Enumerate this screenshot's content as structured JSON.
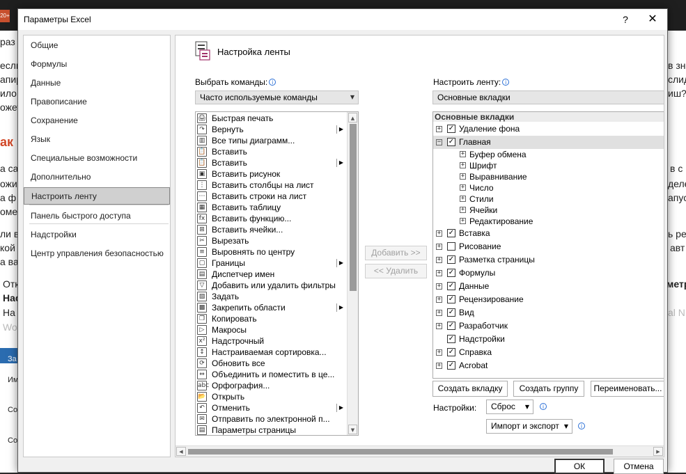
{
  "background": {
    "left_fragments": [
      {
        "text": "раз",
        "style": ""
      },
      {
        "text": "если",
        "style": ""
      },
      {
        "text": "апир",
        "style": ""
      },
      {
        "text": "ило",
        "style": ""
      },
      {
        "text": "ожет",
        "style": ""
      },
      {
        "text": "ак",
        "style": "orange"
      },
      {
        "text": "а са",
        "style": ""
      },
      {
        "text": "ожим",
        "style": ""
      },
      {
        "text": "а ф",
        "style": ""
      },
      {
        "text": "омен",
        "style": ""
      },
      {
        "text": "ли в",
        "style": ""
      },
      {
        "text": "кой",
        "style": ""
      },
      {
        "text": "а ва",
        "style": ""
      },
      {
        "text": "Отк",
        "style": ""
      },
      {
        "text": "Нас",
        "style": "bold"
      },
      {
        "text": "На",
        "style": ""
      },
      {
        "text": "Wo",
        "style": "gray"
      }
    ],
    "right_fragments": [
      {
        "text": "в зн",
        "style": ""
      },
      {
        "text": "слид",
        "style": ""
      },
      {
        "text": "иш?",
        "style": ""
      },
      {
        "text": "в с",
        "style": ""
      },
      {
        "text": "деле",
        "style": ""
      },
      {
        "text": "апус",
        "style": ""
      },
      {
        "text": "ь ре",
        "style": ""
      },
      {
        "text": "авт",
        "style": ""
      },
      {
        "text": "метр",
        "style": "bold"
      },
      {
        "text": "al N",
        "style": "gray"
      }
    ],
    "strip_labels": [
      "За",
      "Им",
      "Со",
      "Со"
    ]
  },
  "dialog": {
    "title": "Параметры Excel",
    "help_glyph": "?",
    "close_glyph": "✕"
  },
  "nav": {
    "items": [
      {
        "label": "Общие",
        "selected": false
      },
      {
        "label": "Формулы",
        "selected": false
      },
      {
        "label": "Данные",
        "selected": false
      },
      {
        "label": "Правописание",
        "selected": false
      },
      {
        "label": "Сохранение",
        "selected": false
      },
      {
        "label": "Язык",
        "selected": false
      },
      {
        "label": "Специальные возможности",
        "selected": false
      },
      {
        "label": "Дополнительно",
        "selected": false
      },
      {
        "label": "Настроить ленту",
        "selected": true
      },
      {
        "label": "Панель быстрого доступа",
        "selected": false
      },
      {
        "label": "Надстройки",
        "selected": false
      },
      {
        "label": "Центр управления безопасностью",
        "selected": false
      }
    ]
  },
  "ribbon": {
    "header_title": "Настройка ленты",
    "choose_commands_label": "Выбрать команды:",
    "choose_commands_value": "Часто используемые команды",
    "customize_ribbon_label": "Настроить ленту:",
    "customize_ribbon_value": "Основные вкладки",
    "add_button": "Добавить >>",
    "remove_button": "<< Удалить",
    "commands": [
      {
        "label": "Быстрая печать",
        "icon": "🖨",
        "submenu": false
      },
      {
        "label": "Вернуть",
        "icon": "↷",
        "submenu": true
      },
      {
        "label": "Все типы диаграмм...",
        "icon": "▥",
        "submenu": false
      },
      {
        "label": "Вставить",
        "icon": "📋",
        "submenu": false
      },
      {
        "label": "Вставить",
        "icon": "📋",
        "submenu": true
      },
      {
        "label": "Вставить рисунок",
        "icon": "▣",
        "submenu": false
      },
      {
        "label": "Вставить столбцы на лист",
        "icon": "⋮",
        "submenu": false
      },
      {
        "label": "Вставить строки на лист",
        "icon": "⋯",
        "submenu": false
      },
      {
        "label": "Вставить таблицу",
        "icon": "▦",
        "submenu": false
      },
      {
        "label": "Вставить функцию...",
        "icon": "fx",
        "submenu": false
      },
      {
        "label": "Вставить ячейки...",
        "icon": "⊞",
        "submenu": false
      },
      {
        "label": "Вырезать",
        "icon": "✂",
        "submenu": false
      },
      {
        "label": "Выровнять по центру",
        "icon": "≡",
        "submenu": false
      },
      {
        "label": "Границы",
        "icon": "▢",
        "submenu": true
      },
      {
        "label": "Диспетчер имен",
        "icon": "▤",
        "submenu": false
      },
      {
        "label": "Добавить или удалить фильтры",
        "icon": "▽",
        "submenu": false
      },
      {
        "label": "Задать",
        "icon": "▧",
        "submenu": false
      },
      {
        "label": "Закрепить области",
        "icon": "▩",
        "submenu": true
      },
      {
        "label": "Копировать",
        "icon": "❐",
        "submenu": false
      },
      {
        "label": "Макросы",
        "icon": "▷",
        "submenu": false
      },
      {
        "label": "Надстрочный",
        "icon": "x²",
        "submenu": false
      },
      {
        "label": "Настраиваемая сортировка...",
        "icon": "↕",
        "submenu": false
      },
      {
        "label": "Обновить все",
        "icon": "⟳",
        "submenu": false
      },
      {
        "label": "Объединить и поместить в це...",
        "icon": "⇔",
        "submenu": false
      },
      {
        "label": "Орфография...",
        "icon": "abc",
        "submenu": false
      },
      {
        "label": "Открыть",
        "icon": "📂",
        "submenu": false
      },
      {
        "label": "Отменить",
        "icon": "↶",
        "submenu": true
      },
      {
        "label": "Отправить по электронной п...",
        "icon": "✉",
        "submenu": false
      },
      {
        "label": "Параметры страницы",
        "icon": "▤",
        "submenu": false
      }
    ],
    "tree_header": "Основные вкладки",
    "tree": [
      {
        "label": "Удаление фона",
        "level": 0,
        "expander": "+",
        "checkbox": true,
        "checked": true,
        "selected": false
      },
      {
        "label": "Главная",
        "level": 0,
        "expander": "−",
        "checkbox": true,
        "checked": true,
        "selected": true
      },
      {
        "label": "Буфер обмена",
        "level": 1,
        "expander": "+",
        "checkbox": false,
        "checked": false,
        "selected": false
      },
      {
        "label": "Шрифт",
        "level": 1,
        "expander": "+",
        "checkbox": false,
        "checked": false,
        "selected": false
      },
      {
        "label": "Выравнивание",
        "level": 1,
        "expander": "+",
        "checkbox": false,
        "checked": false,
        "selected": false
      },
      {
        "label": "Число",
        "level": 1,
        "expander": "+",
        "checkbox": false,
        "checked": false,
        "selected": false
      },
      {
        "label": "Стили",
        "level": 1,
        "expander": "+",
        "checkbox": false,
        "checked": false,
        "selected": false
      },
      {
        "label": "Ячейки",
        "level": 1,
        "expander": "+",
        "checkbox": false,
        "checked": false,
        "selected": false
      },
      {
        "label": "Редактирование",
        "level": 1,
        "expander": "+",
        "checkbox": false,
        "checked": false,
        "selected": false
      },
      {
        "label": "Вставка",
        "level": 0,
        "expander": "+",
        "checkbox": true,
        "checked": true,
        "selected": false
      },
      {
        "label": "Рисование",
        "level": 0,
        "expander": "+",
        "checkbox": true,
        "checked": false,
        "selected": false
      },
      {
        "label": "Разметка страницы",
        "level": 0,
        "expander": "+",
        "checkbox": true,
        "checked": true,
        "selected": false
      },
      {
        "label": "Формулы",
        "level": 0,
        "expander": "+",
        "checkbox": true,
        "checked": true,
        "selected": false
      },
      {
        "label": "Данные",
        "level": 0,
        "expander": "+",
        "checkbox": true,
        "checked": true,
        "selected": false
      },
      {
        "label": "Рецензирование",
        "level": 0,
        "expander": "+",
        "checkbox": true,
        "checked": true,
        "selected": false
      },
      {
        "label": "Вид",
        "level": 0,
        "expander": "+",
        "checkbox": true,
        "checked": true,
        "selected": false
      },
      {
        "label": "Разработчик",
        "level": 0,
        "expander": "+",
        "checkbox": true,
        "checked": true,
        "selected": false
      },
      {
        "label": "Надстройки",
        "level": 0,
        "expander": "",
        "checkbox": true,
        "checked": true,
        "selected": false
      },
      {
        "label": "Справка",
        "level": 0,
        "expander": "+",
        "checkbox": true,
        "checked": true,
        "selected": false
      },
      {
        "label": "Acrobat",
        "level": 0,
        "expander": "+",
        "checkbox": true,
        "checked": true,
        "selected": false
      }
    ],
    "new_tab_button": "Создать вкладку",
    "new_group_button": "Создать группу",
    "rename_button": "Переименовать...",
    "settings_label": "Настройки:",
    "reset_button": "Сброс",
    "import_export_button": "Импорт и экспорт"
  },
  "footer": {
    "ok": "ОК",
    "cancel": "Отмена"
  }
}
